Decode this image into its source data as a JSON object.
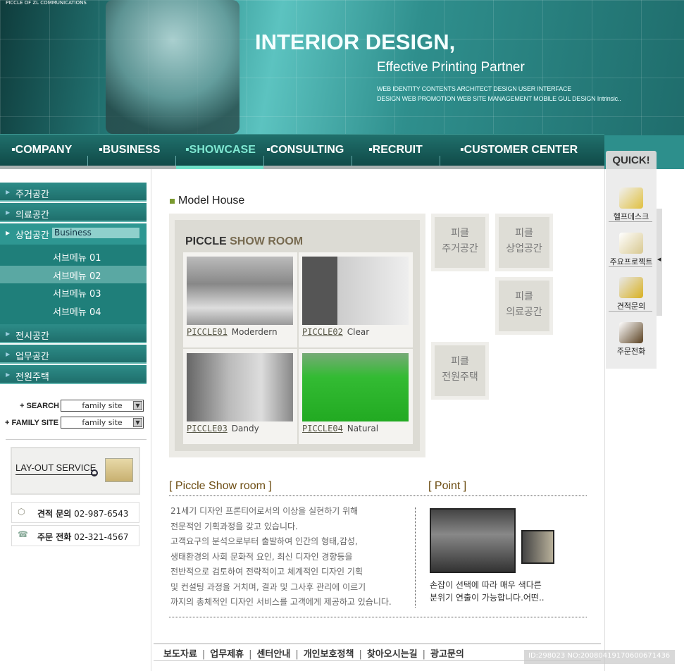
{
  "header": {
    "tagline_small": "PICCLE OF ZL COMMUNICATIONS",
    "title": "INTERIOR DESIGN,",
    "subtitle": "Effective Printing Partner",
    "desc_line1": "WEB IDENTITY CONTENTS ARCHITECT DESIGN USER INTERFACE",
    "desc_line2": "DESIGN WEB PROMOTION WEB SITE MANAGEMENT MOBILE GUL DESIGN Intrinsic.."
  },
  "nav": {
    "items": [
      {
        "label": "▪COMPANY"
      },
      {
        "label": "▪BUSINESS"
      },
      {
        "label": "▪SHOWCASE",
        "active": true
      },
      {
        "label": "▪CONSULTING"
      },
      {
        "label": "▪RECRUIT"
      },
      {
        "label": "▪CUSTOMER CENTER"
      }
    ],
    "accent": "#6fe0c8"
  },
  "quick": {
    "tab": "QUICK!",
    "items": [
      {
        "label": "헬프데스크",
        "icon": "helpdesk-icon"
      },
      {
        "label": "주요프로젝트",
        "icon": "box-icon"
      },
      {
        "label": "견적문의",
        "icon": "pen-icon"
      },
      {
        "label": "주문전화",
        "icon": "phone-icon"
      }
    ]
  },
  "sidebar": {
    "menu": [
      "주거공간",
      "의료공간",
      "상업공간",
      "전시공간",
      "업무공간",
      "전원주택"
    ],
    "active_tag": "Business",
    "submenu": [
      "서브메뉴 01",
      "서브메뉴 02",
      "서브메뉴 03",
      "서브메뉴 04"
    ],
    "search_label": "+ SEARCH",
    "search_value": "family site",
    "family_label": "+ FAMILY SITE",
    "family_value": "family site",
    "layout_service": "LAY-OUT SERVICE",
    "contact1_label": "견적 문의",
    "contact1_num": "02-987-6543",
    "contact2_label": "주문 전화",
    "contact2_num": "02-321-4567"
  },
  "main": {
    "title": "Model House",
    "showroom_title_a": "PICCLE",
    "showroom_title_b": "SHOW ROOM",
    "cells": [
      {
        "code": "PICCLE01",
        "name": "Moderdern"
      },
      {
        "code": "PICCLE02",
        "name": "Clear"
      },
      {
        "code": "PICCLE03",
        "name": "Dandy"
      },
      {
        "code": "PICCLE04",
        "name": "Natural"
      }
    ],
    "tiles": [
      {
        "l1": "피클",
        "l2": "주거공간"
      },
      {
        "l1": "피클",
        "l2": "상업공간"
      },
      {
        "l1": "피클",
        "l2": "의료공간"
      },
      {
        "l1": "피클",
        "l2": "전원주택"
      }
    ],
    "section1": "[ Piccle Show room ]",
    "section2": "[ Point ]",
    "para": [
      "21세기 디자인 프론티어로서의 이상을 실현하기 위해",
      "전문적인 기획과정을 갖고 있습니다.",
      "고객요구의 분석으로부터 출발하여 인간의 형태,감성,",
      "생태환경의 사회 문화적 요인, 최신 디자인 경향등을",
      "전반적으로 검토하여 전략적이고 체계적인 디자인 기획",
      "및 컨설팅 과정을 거치며, 결과 및 그사후 관리에 이르기",
      "까지의 총체적인 디자인 서비스를 고객에게 제공하고 있습니다."
    ],
    "point": [
      "손잡이 선택에 따라 매우 색다른",
      "분위기 연출이 가능합니다.어떤.."
    ]
  },
  "footer": {
    "links": [
      "보도자료",
      "업무제휴",
      "센터안내",
      "개인보호정책",
      "찾아오시는길",
      "광고문의"
    ]
  },
  "watermark": "ID:298023 NO:20080419170600671436"
}
